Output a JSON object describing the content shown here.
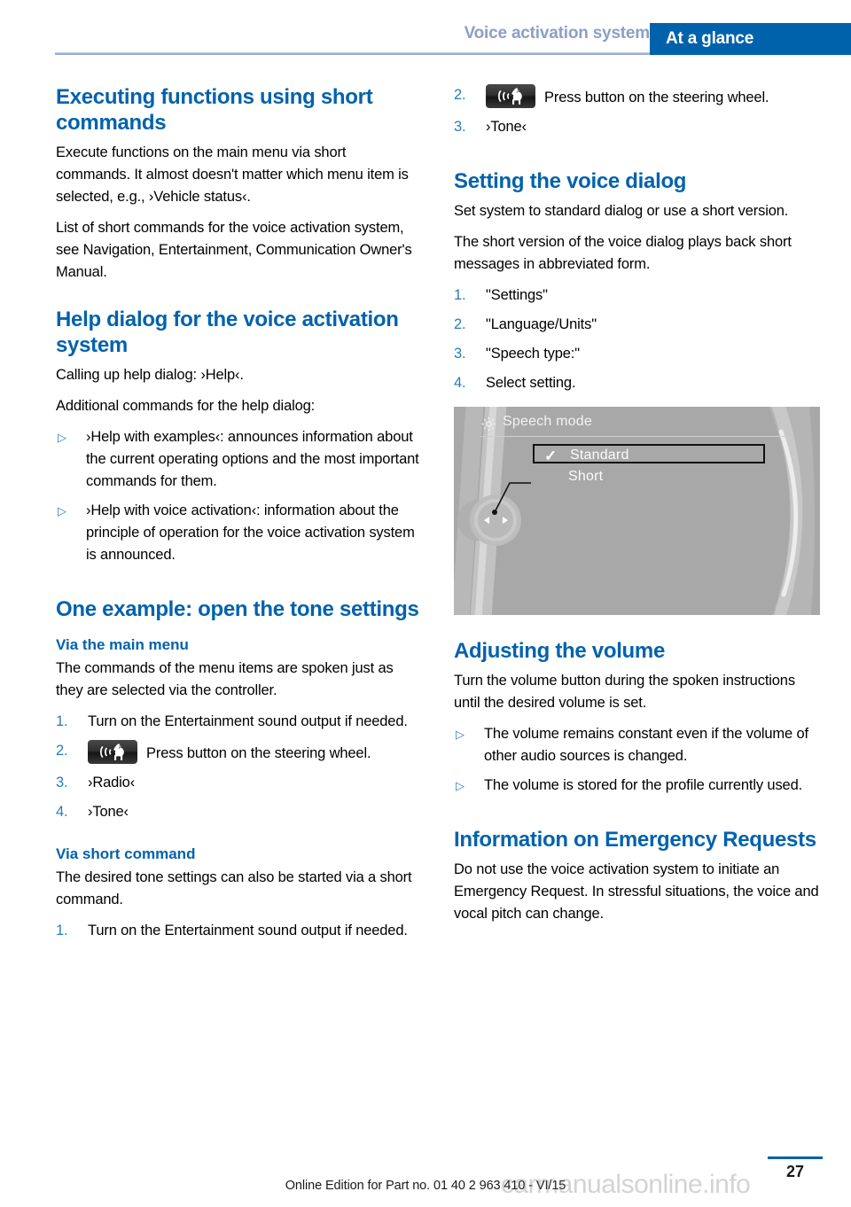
{
  "header": {
    "chapter": "Voice activation system",
    "section": "At a glance",
    "accent_color": "#0162ac",
    "chapter_color": "#8c9fc4"
  },
  "left_column": {
    "heading_1": "Executing functions using short commands",
    "para_1": "Execute functions on the main menu via short commands. It almost doesn't matter which menu item is selected, e.g., ›Vehicle status‹.",
    "para_2": "List of short commands for the voice activation system, see Navigation, Entertainment, Communication Owner's Manual.",
    "heading_2": "Help dialog for the voice activation system",
    "para_3": "Calling up help dialog: ›Help‹.",
    "para_4": "Additional commands for the help dialog:",
    "help_bullets": [
      "›Help with examples‹: announces information about the current operating options and the most important commands for them.",
      "›Help with voice activation‹: information about the principle of operation for the voice activation system is announced."
    ],
    "heading_3": "One example: open the tone settings",
    "subheading_1": "Via the main menu",
    "para_5": "The commands of the menu items are spoken just as they are selected via the controller.",
    "main_menu_steps": [
      {
        "num": "1.",
        "text": "Turn on the Entertainment sound output if needed.",
        "icon": ""
      },
      {
        "num": "2.",
        "text": "Press button on the steering wheel.",
        "icon": "voice-button-icon"
      },
      {
        "num": "3.",
        "text": "›Radio‹",
        "icon": ""
      },
      {
        "num": "4.",
        "text": "›Tone‹",
        "icon": ""
      }
    ],
    "subheading_2": "Via short command",
    "para_6": "The desired tone settings can also be started via a short command.",
    "short_cmd_steps": [
      {
        "num": "1.",
        "text": "Turn on the Entertainment sound output if needed.",
        "icon": ""
      }
    ]
  },
  "right_column": {
    "continued_steps": [
      {
        "num": "2.",
        "text": "Press button on the steering wheel.",
        "icon": "voice-button-icon"
      },
      {
        "num": "3.",
        "text": "›Tone‹",
        "icon": ""
      }
    ],
    "heading_1": "Setting the voice dialog",
    "para_1": "Set system to standard dialog or use a short version.",
    "para_2": "The short version of the voice dialog plays back short messages in abbreviated form.",
    "dialog_steps": [
      {
        "num": "1.",
        "text": "\"Settings\""
      },
      {
        "num": "2.",
        "text": "\"Language/Units\""
      },
      {
        "num": "3.",
        "text": "\"Speech type:\""
      },
      {
        "num": "4.",
        "text": "Select setting."
      }
    ],
    "idrive": {
      "title": "Speech mode",
      "gear_icon": "gear-icon",
      "options": [
        {
          "label": "Standard",
          "checked": true,
          "highlighted": true
        },
        {
          "label": "Short",
          "checked": false,
          "highlighted": false
        }
      ],
      "background_color": "#a8a8a8"
    },
    "heading_2": "Adjusting the volume",
    "para_3": "Turn the volume button during the spoken instructions until the desired volume is set.",
    "volume_bullets": [
      "The volume remains constant even if the volume of other audio sources is changed.",
      "The volume is stored for the profile currently used."
    ],
    "heading_3": "Information on Emergency Requests",
    "para_4": "Do not use the voice activation system to initiate an Emergency Request. In stressful situations, the voice and vocal pitch can change."
  },
  "footer": {
    "edition": "Online Edition for Part no. 01 40 2 963 410 - VI/15",
    "page_number": "27",
    "watermark": "carmanualsonline.info"
  },
  "icons": {
    "bullet_glyph": "▷",
    "check_glyph": "✓"
  }
}
